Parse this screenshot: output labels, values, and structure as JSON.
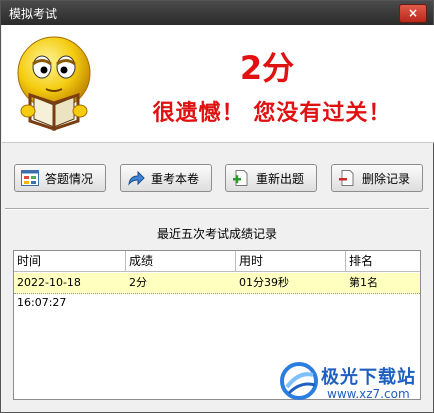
{
  "window": {
    "title": "模拟考试",
    "close_label": "×"
  },
  "result": {
    "score": "2分",
    "message": "很遗憾！ 您没有过关！"
  },
  "toolbar": {
    "buttons": [
      {
        "label": "答题情况",
        "icon": "grid-icon"
      },
      {
        "label": "重考本卷",
        "icon": "redo-arrow-icon"
      },
      {
        "label": "重新出题",
        "icon": "new-document-icon"
      },
      {
        "label": "删除记录",
        "icon": "delete-document-icon"
      }
    ]
  },
  "records": {
    "title": "最近五次考试成绩记录",
    "columns": [
      "时间",
      "成绩",
      "用时",
      "排名"
    ],
    "rows": [
      [
        "2022-10-18 16:07:27",
        "2分",
        "01分39秒",
        "第1名"
      ]
    ],
    "selected_row_color": "#ffffc0"
  },
  "watermark": {
    "name": "极光下载站",
    "url": "www.xz7.com"
  },
  "colors": {
    "accent_red": "#e11111",
    "titlebar": "#333333"
  }
}
